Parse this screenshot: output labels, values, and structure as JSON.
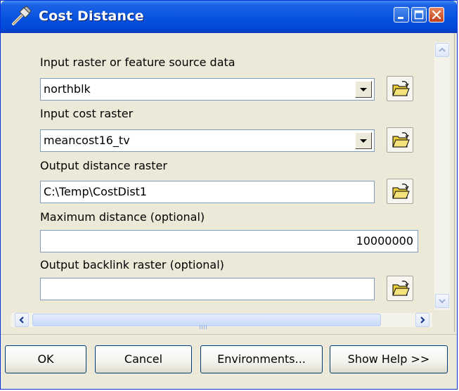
{
  "window": {
    "title": "Cost Distance",
    "title_icon": "hammer-icon",
    "controls": [
      "minimize-icon",
      "maximize-icon",
      "close-icon"
    ]
  },
  "form": {
    "input_source": {
      "label": "Input raster or feature source data",
      "value": "northblk"
    },
    "input_cost": {
      "label": "Input cost raster",
      "value": "meancost16_tv"
    },
    "output_distance": {
      "label": "Output distance raster",
      "value": "C:\\Temp\\CostDist1"
    },
    "max_distance": {
      "label": "Maximum distance (optional)",
      "value": "10000000"
    },
    "output_backlink": {
      "label": "Output backlink raster (optional)",
      "value": ""
    }
  },
  "buttons": {
    "ok": "OK",
    "cancel": "Cancel",
    "environments": "Environments...",
    "show_help": "Show Help >>"
  },
  "colors": {
    "titlebar": "#0a54e0",
    "dialog_background": "#ece9d8",
    "field_border": "#7f9db9"
  }
}
